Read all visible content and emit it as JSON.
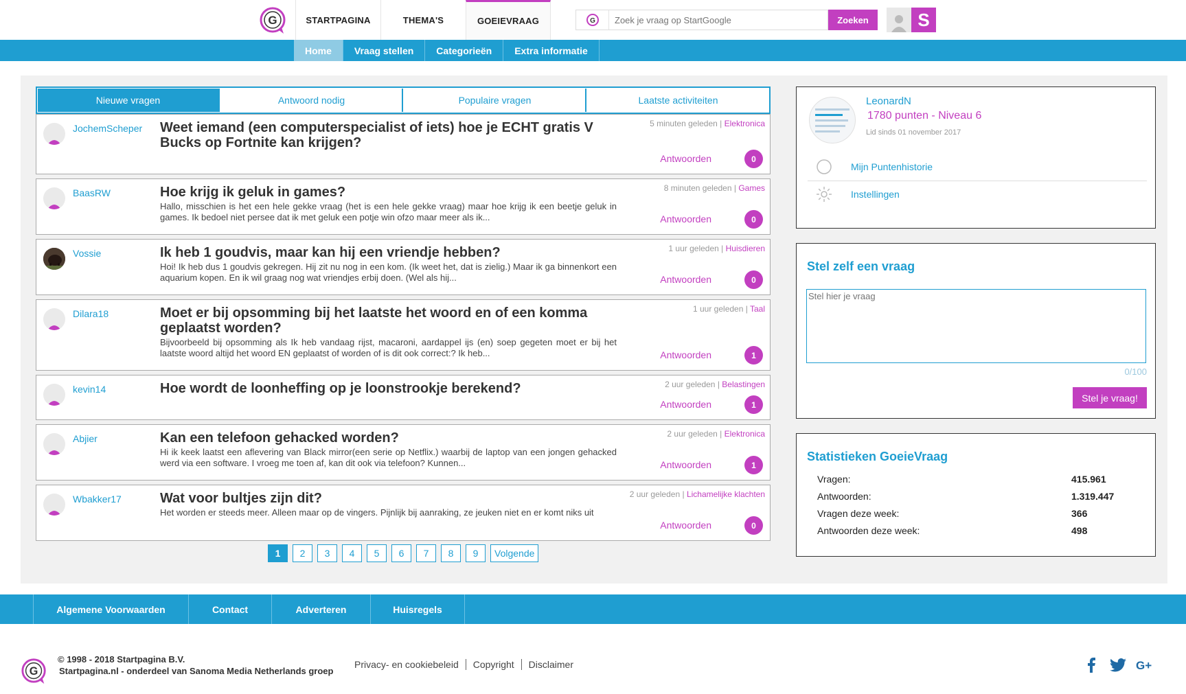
{
  "header": {
    "nav": [
      {
        "label": "STARTPAGINA",
        "active": false
      },
      {
        "label": "THEMA'S",
        "active": false
      },
      {
        "label": "GOEIEVRAAG",
        "active": true
      }
    ],
    "search_placeholder": "Zoek je vraag op StartGoogle",
    "search_button": "Zoeken",
    "s_label": "S"
  },
  "subnav": [
    {
      "label": "Home",
      "active": true
    },
    {
      "label": "Vraag stellen",
      "active": false
    },
    {
      "label": "Categorieën",
      "active": false
    },
    {
      "label": "Extra informatie",
      "active": false
    }
  ],
  "tabs": [
    {
      "label": "Nieuwe vragen",
      "active": true
    },
    {
      "label": "Antwoord nodig",
      "active": false
    },
    {
      "label": "Populaire vragen",
      "active": false
    },
    {
      "label": "Laatste activiteiten",
      "active": false
    }
  ],
  "questions": [
    {
      "user": "JochemScheper",
      "title": "Weet iemand (een computerspecialist of iets) hoe je ECHT gratis V Bucks op Fortnite kan krijgen?",
      "body": "",
      "time": "5 minuten geleden",
      "category": "Elektronica",
      "answer_label": "Antwoorden",
      "count": "0",
      "photo": false
    },
    {
      "user": "BaasRW",
      "title": "Hoe krijg ik geluk in games?",
      "body": "Hallo, misschien is het een hele gekke vraag (het is een hele gekke vraag) maar hoe krijg ik een beetje geluk in games. Ik bedoel niet persee dat ik met geluk een potje win ofzo maar meer als ik...",
      "time": "8 minuten geleden",
      "category": "Games",
      "answer_label": "Antwoorden",
      "count": "0",
      "photo": false
    },
    {
      "user": "Vossie",
      "title": "Ik heb 1 goudvis, maar kan hij een vriendje hebben?",
      "body": "Hoi! Ik heb dus 1 goudvis gekregen. Hij zit nu nog in een kom. (Ik weet het, dat is zielig.) Maar ik ga binnenkort een aquarium kopen. En ik wil graag nog wat vriendjes erbij doen. (Wel als hij...",
      "time": "1 uur geleden",
      "category": "Huisdieren",
      "answer_label": "Antwoorden",
      "count": "0",
      "photo": true
    },
    {
      "user": "Dilara18",
      "title": "Moet er bij opsomming bij het laatste het woord en of een komma geplaatst worden?",
      "body": "Bijvoorbeeld bij opsomming als Ik heb vandaag rijst, macaroni, aardappel ijs (en) soep gegeten moet er bij het laatste woord altijd het woord EN geplaatst of worden of is dit ook correct:? Ik heb...",
      "time": "1 uur geleden",
      "category": "Taal",
      "answer_label": "Antwoorden",
      "count": "1",
      "photo": false
    },
    {
      "user": "kevin14",
      "title": "Hoe wordt de loonheffing op je loonstrookje berekend?",
      "body": "",
      "time": "2 uur geleden",
      "category": "Belastingen",
      "answer_label": "Antwoorden",
      "count": "1",
      "photo": false
    },
    {
      "user": "Abjier",
      "title": "Kan een telefoon gehacked worden?",
      "body": "Hi ik keek laatst een aflevering van Black mirror(een serie op Netflix.) waarbij de laptop van een jongen gehacked werd via een software. I vroeg me toen af, kan dit ook via telefoon? Kunnen...",
      "time": "2 uur geleden",
      "category": "Elektronica",
      "answer_label": "Antwoorden",
      "count": "1",
      "photo": false
    },
    {
      "user": "Wbakker17",
      "title": "Wat voor bultjes zijn dit?",
      "body": "Het worden er steeds meer. Alleen maar op de vingers. Pijnlijk bij aanraking, ze jeuken niet en er komt niks uit",
      "time": "2 uur geleden",
      "category": "Lichamelijke klachten",
      "answer_label": "Antwoorden",
      "count": "0",
      "photo": false
    }
  ],
  "pagination": {
    "pages": [
      "1",
      "2",
      "3",
      "4",
      "5",
      "6",
      "7",
      "8",
      "9"
    ],
    "current": "1",
    "next_label": "Volgende"
  },
  "profile": {
    "name": "LeonardN",
    "points": "1780 punten - Niveau 6",
    "since": "Lid sinds 01 november 2017",
    "links": [
      "Mijn Puntenhistorie",
      "Instellingen"
    ]
  },
  "ask": {
    "title": "Stel zelf een vraag",
    "placeholder": "Stel hier je vraag",
    "counter": "0/100",
    "button": "Stel je vraag!"
  },
  "stats": {
    "title": "Statistieken GoeieVraag",
    "rows": [
      {
        "label": "Vragen:",
        "value": "415.961"
      },
      {
        "label": "Antwoorden:",
        "value": "1.319.447"
      },
      {
        "label": "Vragen deze week:",
        "value": "366"
      },
      {
        "label": "Antwoorden deze week:",
        "value": "498"
      }
    ]
  },
  "footer": {
    "nav": [
      "Algemene Voorwaarden",
      "Contact",
      "Adverteren",
      "Huisregels"
    ],
    "copyright": "© 1998 - 2018 Startpagina B.V.",
    "tagline": "Startpagina.nl - onderdeel van Sanoma Media Netherlands groep",
    "links": [
      "Privacy- en cookiebeleid",
      "Copyright",
      "Disclaimer"
    ],
    "social": [
      "facebook-icon",
      "twitter-icon",
      "google-plus-icon"
    ]
  },
  "colors": {
    "brand_blue": "#1f9ed1",
    "brand_purple": "#c23fc0"
  }
}
